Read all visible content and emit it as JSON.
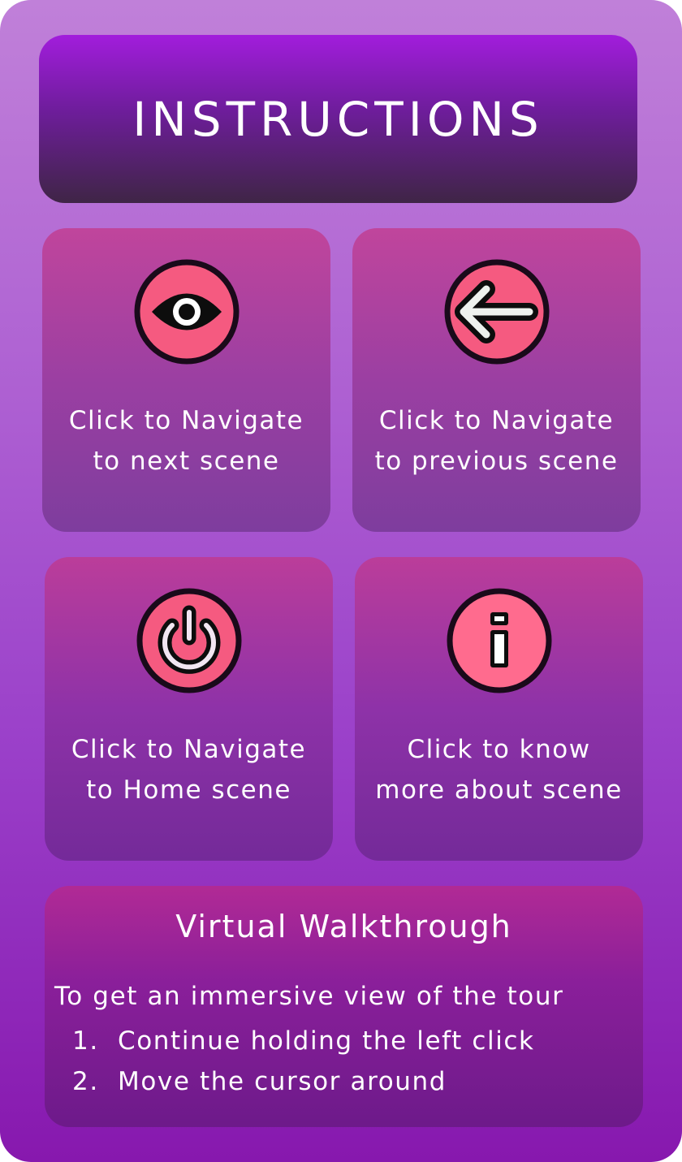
{
  "header": {
    "title": "INSTRUCTIONS"
  },
  "cards": [
    {
      "icon": "eye-icon",
      "lines": [
        "Click to Navigate",
        "to next scene"
      ]
    },
    {
      "icon": "arrow-left-icon",
      "lines": [
        "Click to Navigate",
        "to previous scene"
      ]
    },
    {
      "icon": "power-icon",
      "lines": [
        "Click to Navigate",
        "to Home scene"
      ]
    },
    {
      "icon": "info-icon",
      "lines": [
        "Click to know",
        "more about scene"
      ]
    }
  ],
  "walkthrough": {
    "title": "Virtual Walkthrough",
    "intro": "To get an immersive view of the tour",
    "steps": [
      {
        "number": "1.",
        "text": "Continue holding the left click"
      },
      {
        "number": "2.",
        "text": "Move the cursor around"
      }
    ]
  },
  "colors": {
    "icon_fill": "#f55a80",
    "icon_outline": "#1a0a1a",
    "accent_purple": "#a21ddc"
  }
}
